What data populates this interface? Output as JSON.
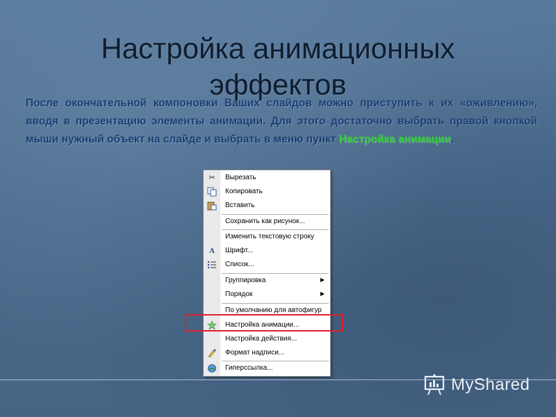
{
  "slide": {
    "title_line1": "Настройка анимационных",
    "title_line2": "эффектов",
    "paragraph_before": "После окончательной компоновки Ваших слайдов можно приступить к их «оживлению», вводя в презентацию элементы анимации. Для этого достаточно выбрать правой кнопкой мыши нужный объект на слайде и выбрать в меню пункт ",
    "paragraph_highlight": "Настройка анимации",
    "paragraph_after": ".",
    "highlight_color": "#2ed02e",
    "text_color": "#1b3f73"
  },
  "context_menu": {
    "items": [
      {
        "label": "Вырезать",
        "icon": "scissors-icon"
      },
      {
        "label": "Копировать",
        "icon": "copy-icon"
      },
      {
        "label": "Вставить",
        "icon": "paste-icon"
      },
      {
        "label": "Сохранить как рисунок...",
        "icon": ""
      },
      {
        "label": "Изменить текстовую строку",
        "icon": ""
      },
      {
        "label": "Шрифт...",
        "icon": "font-icon"
      },
      {
        "label": "Список...",
        "icon": "list-icon"
      },
      {
        "label": "Группировка",
        "icon": "",
        "submenu": true
      },
      {
        "label": "Порядок",
        "icon": "",
        "submenu": true
      },
      {
        "label": "По умолчанию для автофигур",
        "icon": ""
      },
      {
        "label": "Настройка анимации...",
        "icon": "animation-icon",
        "highlighted": true
      },
      {
        "label": "Настройка действия...",
        "icon": ""
      },
      {
        "label": "Формат надписи...",
        "icon": "format-icon"
      },
      {
        "label": "Гиперссылка...",
        "icon": "hyperlink-icon"
      }
    ],
    "highlight_border_color": "#e0202a"
  },
  "watermark": {
    "text": "MyShared",
    "icon": "presentation-board-icon"
  }
}
